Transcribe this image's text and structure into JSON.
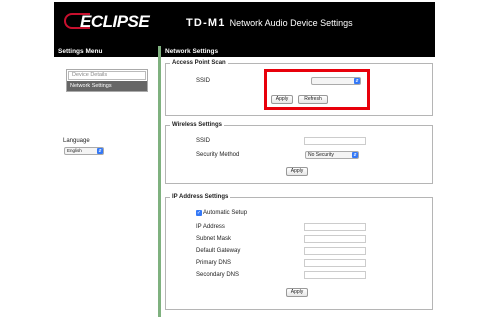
{
  "header": {
    "logo_text": "ECLIPSE",
    "model": "TD-M1",
    "title": "Network Audio Device Settings"
  },
  "sidebar": {
    "heading": "Settings Menu",
    "items": [
      {
        "label": "Device Details",
        "active": false
      },
      {
        "label": "Network Settings",
        "active": true
      }
    ],
    "language_label": "Language",
    "language_value": "English"
  },
  "main": {
    "heading": "Network Settings",
    "access_point_scan": {
      "legend": "Access Point Scan",
      "ssid_label": "SSID",
      "ssid_value": "",
      "apply_label": "Apply",
      "refresh_label": "Refresh"
    },
    "wireless": {
      "legend": "Wireless Settings",
      "ssid_label": "SSID",
      "ssid_value": "",
      "security_label": "Security Method",
      "security_value": "No Security",
      "apply_label": "Apply"
    },
    "ip": {
      "legend": "IP Address Settings",
      "auto_setup_label": "Automatic Setup",
      "auto_setup_checked": true,
      "ip_label": "IP Address",
      "subnet_label": "Subnet Mask",
      "gateway_label": "Default Gateway",
      "dns1_label": "Primary DNS",
      "dns2_label": "Secondary DNS",
      "apply_label": "Apply"
    }
  },
  "colors": {
    "header_bg": "#000000",
    "divider": "#7fb17f",
    "highlight": "#e8000b",
    "select_accent": "#3478f6",
    "menu_active": "#666666"
  },
  "icons": {
    "select_arrow": "chevron-updown-icon",
    "checkbox": "checkmark-icon"
  }
}
